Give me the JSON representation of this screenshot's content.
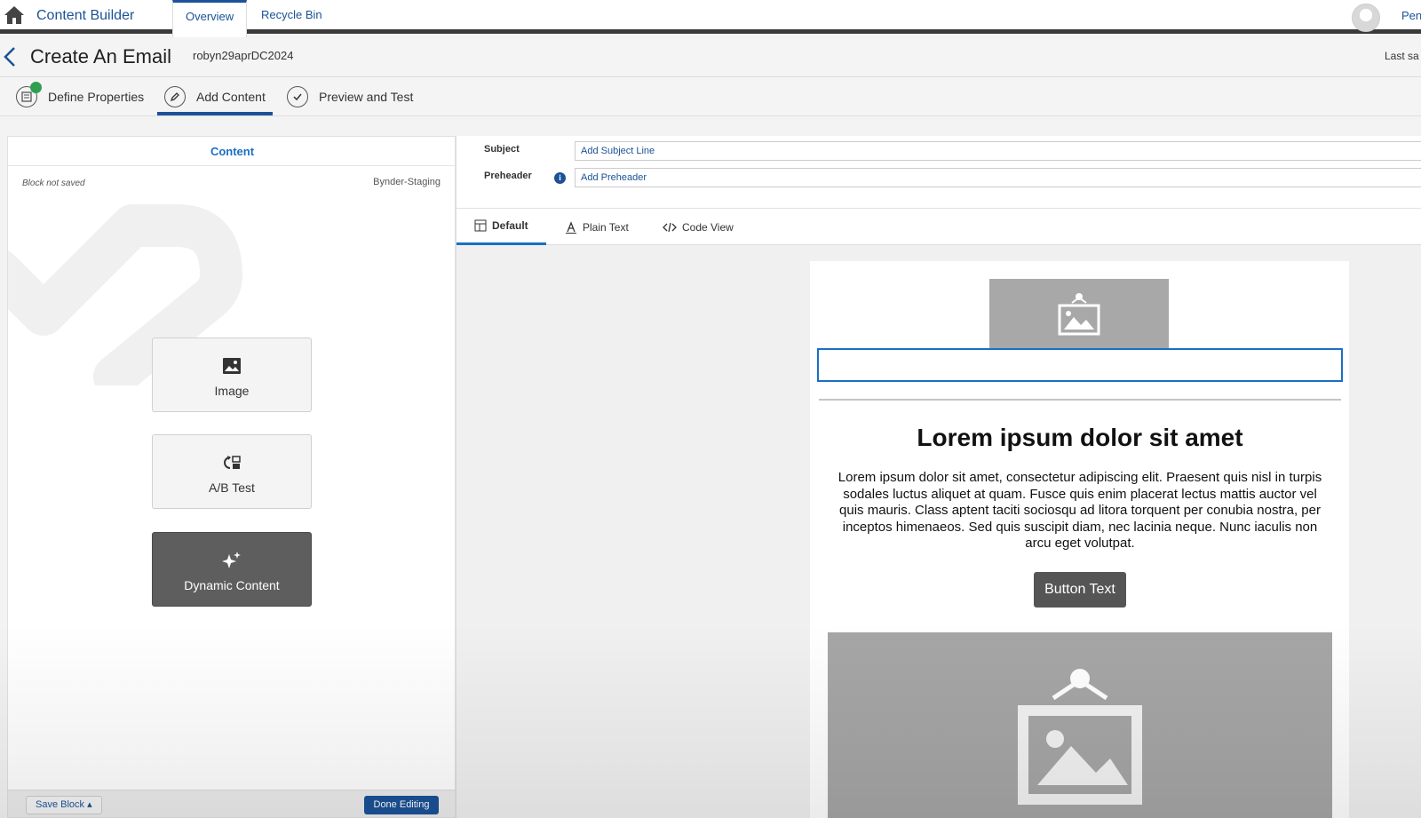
{
  "topnav": {
    "app_name": "Content Builder",
    "tabs": [
      {
        "label": "Overview",
        "active": true
      },
      {
        "label": "Recycle Bin",
        "active": false
      }
    ],
    "user_name": "Pen"
  },
  "titlebar": {
    "title": "Create An Email",
    "email_name": "robyn29aprDC2024",
    "last_saved": "Last sa"
  },
  "steps": [
    {
      "label": "Define Properties",
      "icon": "properties-icon",
      "complete": true
    },
    {
      "label": "Add Content",
      "icon": "pencil-icon",
      "active": true
    },
    {
      "label": "Preview and Test",
      "icon": "check-icon"
    }
  ],
  "left_panel": {
    "heading": "Content",
    "block_status": "Block not saved",
    "block_source": "Bynder-Staging",
    "blocks": [
      {
        "label": "Image",
        "icon": "image-icon",
        "selected": false
      },
      {
        "label": "A/B Test",
        "icon": "ab-test-icon",
        "selected": false
      },
      {
        "label": "Dynamic Content",
        "icon": "sparkle-icon",
        "selected": true
      }
    ],
    "save_block_label": "Save Block ▴",
    "done_editing_label": "Done Editing"
  },
  "fields": {
    "subject_label": "Subject",
    "subject_placeholder": "Add Subject Line",
    "preheader_label": "Preheader",
    "preheader_placeholder": "Add Preheader",
    "info_glyph": "i"
  },
  "view_tabs": [
    {
      "label": "Default",
      "active": true
    },
    {
      "label": "Plain Text"
    },
    {
      "label": "Code View"
    }
  ],
  "email": {
    "heading": "Lorem ipsum dolor sit amet",
    "body": "Lorem ipsum dolor sit amet, consectetur adipiscing elit. Praesent quis nisl in turpis sodales luctus aliquet at quam. Fusce quis enim placerat lectus mattis auctor vel quis mauris. Class aptent taciti sociosqu ad litora torquent per conubia nostra, per inceptos himenaeos. Sed quis suscipit diam, nec lacinia neque. Nunc iaculis non arcu eget volutpat.",
    "button_text": "Button Text"
  },
  "colors": {
    "brand_blue": "#1b5297",
    "accent_blue": "#1b6fc4",
    "selected_block": "#5e5e5e",
    "placeholder_gray": "#a8a8a8"
  }
}
